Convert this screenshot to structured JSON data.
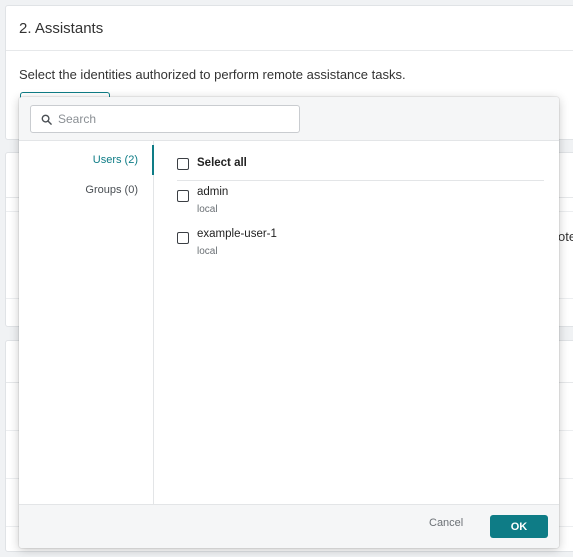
{
  "section": {
    "title": "2. Assistants",
    "description": "Select the identities authorized to perform remote assistance tasks.",
    "clipped_text": "ote"
  },
  "search": {
    "placeholder": "Search",
    "value": ""
  },
  "sidebar": {
    "items": [
      {
        "label": "Users (2)",
        "active": true
      },
      {
        "label": "Groups (0)",
        "active": false
      }
    ]
  },
  "list": {
    "select_all_label": "Select all",
    "users": [
      {
        "name": "admin",
        "source": "local",
        "checked": false
      },
      {
        "name": "example-user-1",
        "source": "local",
        "checked": false
      }
    ]
  },
  "footer": {
    "cancel_label": "Cancel",
    "ok_label": "OK"
  },
  "colors": {
    "accent": "#0e7c86",
    "background": "#f0f2f4"
  },
  "icons": {
    "search": "search-icon"
  }
}
